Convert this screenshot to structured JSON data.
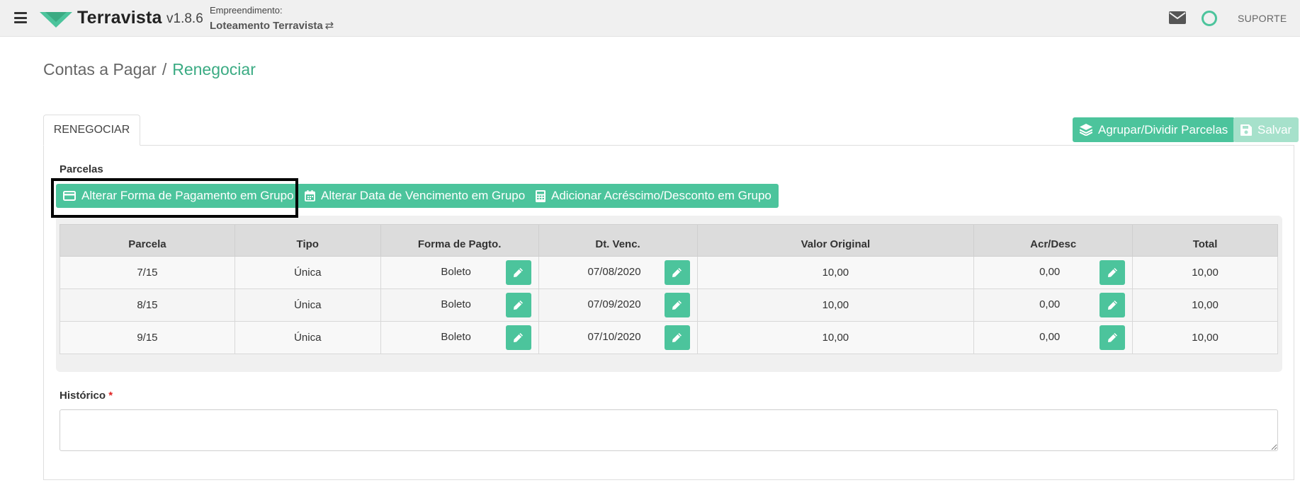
{
  "app": {
    "brand": "Terravista",
    "version": "v1.8.6",
    "empreendimento_label": "Empreendimento:",
    "empreendimento_value": "Loteamento Terravista",
    "swap_glyph": "⇄",
    "support_label": "SUPORTE",
    "brand_color": "#4cc49c"
  },
  "breadcrumb": {
    "parent": "Contas a Pagar",
    "separator": "/",
    "current": "Renegociar"
  },
  "tabs": [
    {
      "label": "RENEGOCIAR",
      "active": true
    }
  ],
  "toolbar": {
    "group_split_label": "Agrupar/Dividir Parcelas",
    "save_label": "Salvar"
  },
  "parcelas": {
    "section_label": "Parcelas",
    "actions": {
      "change_payment": "Alterar Forma de Pagamento em Grupo",
      "change_due_date": "Alterar Data de Vencimento em Grupo",
      "add_adjustment": "Adicionar Acréscimo/Desconto em Grupo"
    },
    "columns": [
      "Parcela",
      "Tipo",
      "Forma de Pagto.",
      "Dt. Venc.",
      "Valor Original",
      "Acr/Desc",
      "Total"
    ],
    "rows": [
      {
        "parcela": "7/15",
        "tipo": "Única",
        "forma": "Boleto",
        "venc": "07/08/2020",
        "valor": "10,00",
        "acr": "0,00",
        "total": "10,00"
      },
      {
        "parcela": "8/15",
        "tipo": "Única",
        "forma": "Boleto",
        "venc": "07/09/2020",
        "valor": "10,00",
        "acr": "0,00",
        "total": "10,00"
      },
      {
        "parcela": "9/15",
        "tipo": "Única",
        "forma": "Boleto",
        "venc": "07/10/2020",
        "valor": "10,00",
        "acr": "0,00",
        "total": "10,00"
      }
    ]
  },
  "historico": {
    "label": "Histórico",
    "required_mark": "*",
    "value": ""
  }
}
